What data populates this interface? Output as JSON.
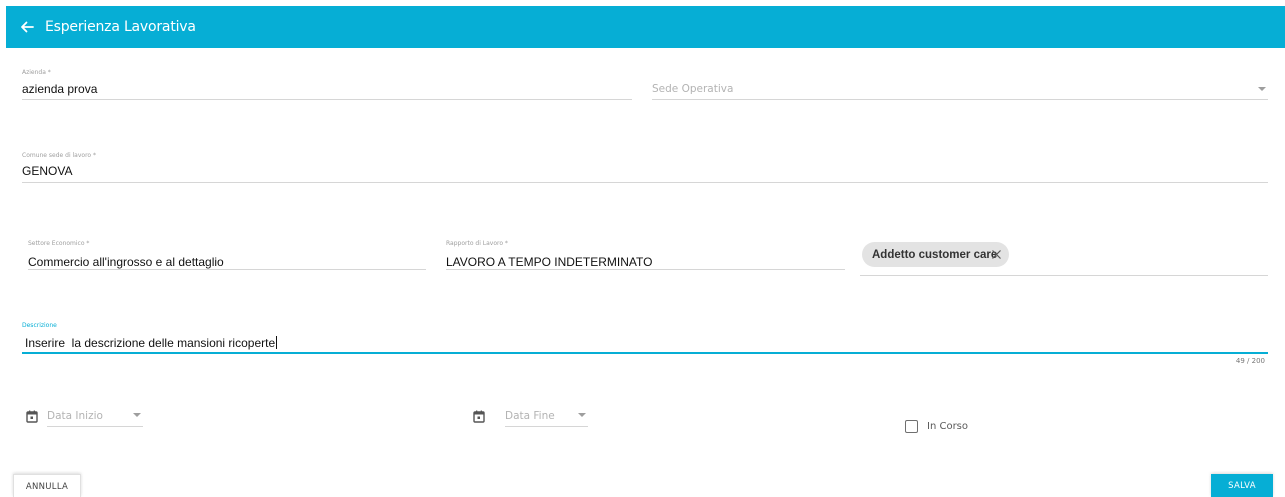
{
  "header": {
    "title": "Esperienza Lavorativa",
    "back_icon": "arrow-left-icon",
    "color": "#06aed5"
  },
  "form": {
    "azienda": {
      "label": "Azienda *",
      "value": "azienda prova"
    },
    "sede_operativa": {
      "placeholder": "Sede Operativa"
    },
    "comune": {
      "label": "Comune sede di lavoro *",
      "value": "GENOVA"
    },
    "settore": {
      "label": "Settore Economico *",
      "value": "Commercio all'ingrosso e al dettaglio"
    },
    "rapporto": {
      "label": "Rapporto di Lavoro *",
      "value": "LAVORO A TEMPO INDETERMINATO"
    },
    "qualifica_chip": {
      "label": "Addetto customer care"
    },
    "descrizione": {
      "label": "Descrizione",
      "value": "Inserire  la descrizione delle mansioni ricoperte",
      "counter": "49 / 200"
    },
    "data_inizio": {
      "placeholder": "Data Inizio",
      "icon": "calendar-icon"
    },
    "data_fine": {
      "placeholder": "Data Fine",
      "icon": "calendar-icon"
    },
    "in_corso": {
      "label": "In Corso",
      "checked": false
    }
  },
  "actions": {
    "cancel_label": "ANNULLA",
    "save_label": "SALVA"
  }
}
